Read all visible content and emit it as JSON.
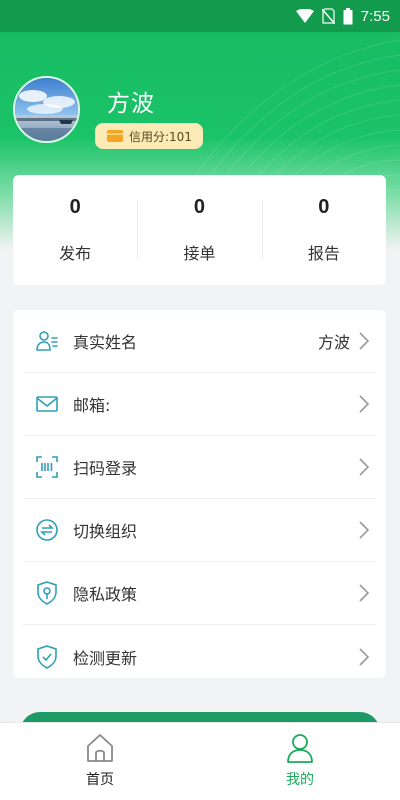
{
  "status_bar": {
    "time": "7:55"
  },
  "profile": {
    "name": "方波",
    "credit_text": "信用分:101"
  },
  "stats": [
    {
      "value": "0",
      "label": "发布"
    },
    {
      "value": "0",
      "label": "接单"
    },
    {
      "value": "0",
      "label": "报告"
    }
  ],
  "menu": [
    {
      "icon": "user-card-icon",
      "label": "真实姓名",
      "value": "方波"
    },
    {
      "icon": "mail-icon",
      "label": "邮箱:",
      "value": ""
    },
    {
      "icon": "scan-icon",
      "label": "扫码登录",
      "value": ""
    },
    {
      "icon": "switch-icon",
      "label": "切换组织",
      "value": ""
    },
    {
      "icon": "privacy-shield-icon",
      "label": "隐私政策",
      "value": ""
    },
    {
      "icon": "check-shield-icon",
      "label": "检测更新",
      "value": ""
    }
  ],
  "tabs": [
    {
      "icon": "home-icon",
      "label": "首页",
      "active": false
    },
    {
      "icon": "person-icon",
      "label": "我的",
      "active": true
    }
  ],
  "colors": {
    "brand_green": "#1bc368",
    "status_bar": "#129a4d",
    "active_tab": "#1bab5a",
    "icon_teal": "#2f9fb8",
    "badge_bg": "#fbe9b6"
  }
}
